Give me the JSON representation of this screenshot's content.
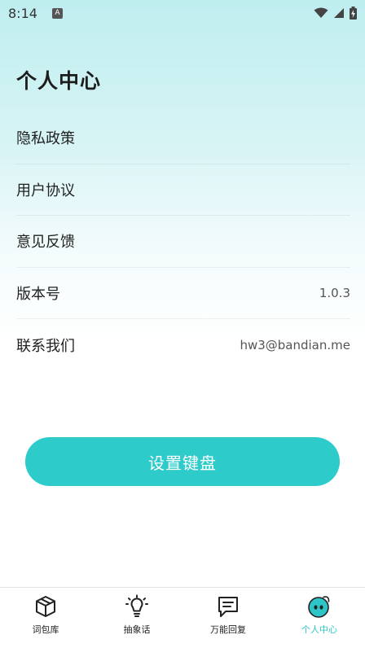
{
  "status_bar": {
    "time": "8:14",
    "notification_icon": "font-a-icon",
    "icons": [
      "wifi-icon",
      "signal-icon",
      "battery-charging-icon"
    ]
  },
  "page": {
    "title": "个人中心"
  },
  "menu": {
    "items": [
      {
        "label": "隐私政策",
        "value": ""
      },
      {
        "label": "用户协议",
        "value": ""
      },
      {
        "label": "意见反馈",
        "value": ""
      },
      {
        "label": "版本号",
        "value": "1.0.3"
      },
      {
        "label": "联系我们",
        "value": "hw3@bandian.me"
      }
    ]
  },
  "setup_button": {
    "label": "设置键盘"
  },
  "bottom_nav": {
    "active_color": "#2ec5c8",
    "items": [
      {
        "label": "词包库",
        "icon": "package-box-icon"
      },
      {
        "label": "抽象话",
        "icon": "lightbulb-icon"
      },
      {
        "label": "万能回复",
        "icon": "message-text-icon"
      },
      {
        "label": "个人中心",
        "icon": "avatar-face-icon",
        "active": true
      }
    ]
  },
  "colors": {
    "accent": "#2ecbcb",
    "background_top": "#bfeeef"
  }
}
